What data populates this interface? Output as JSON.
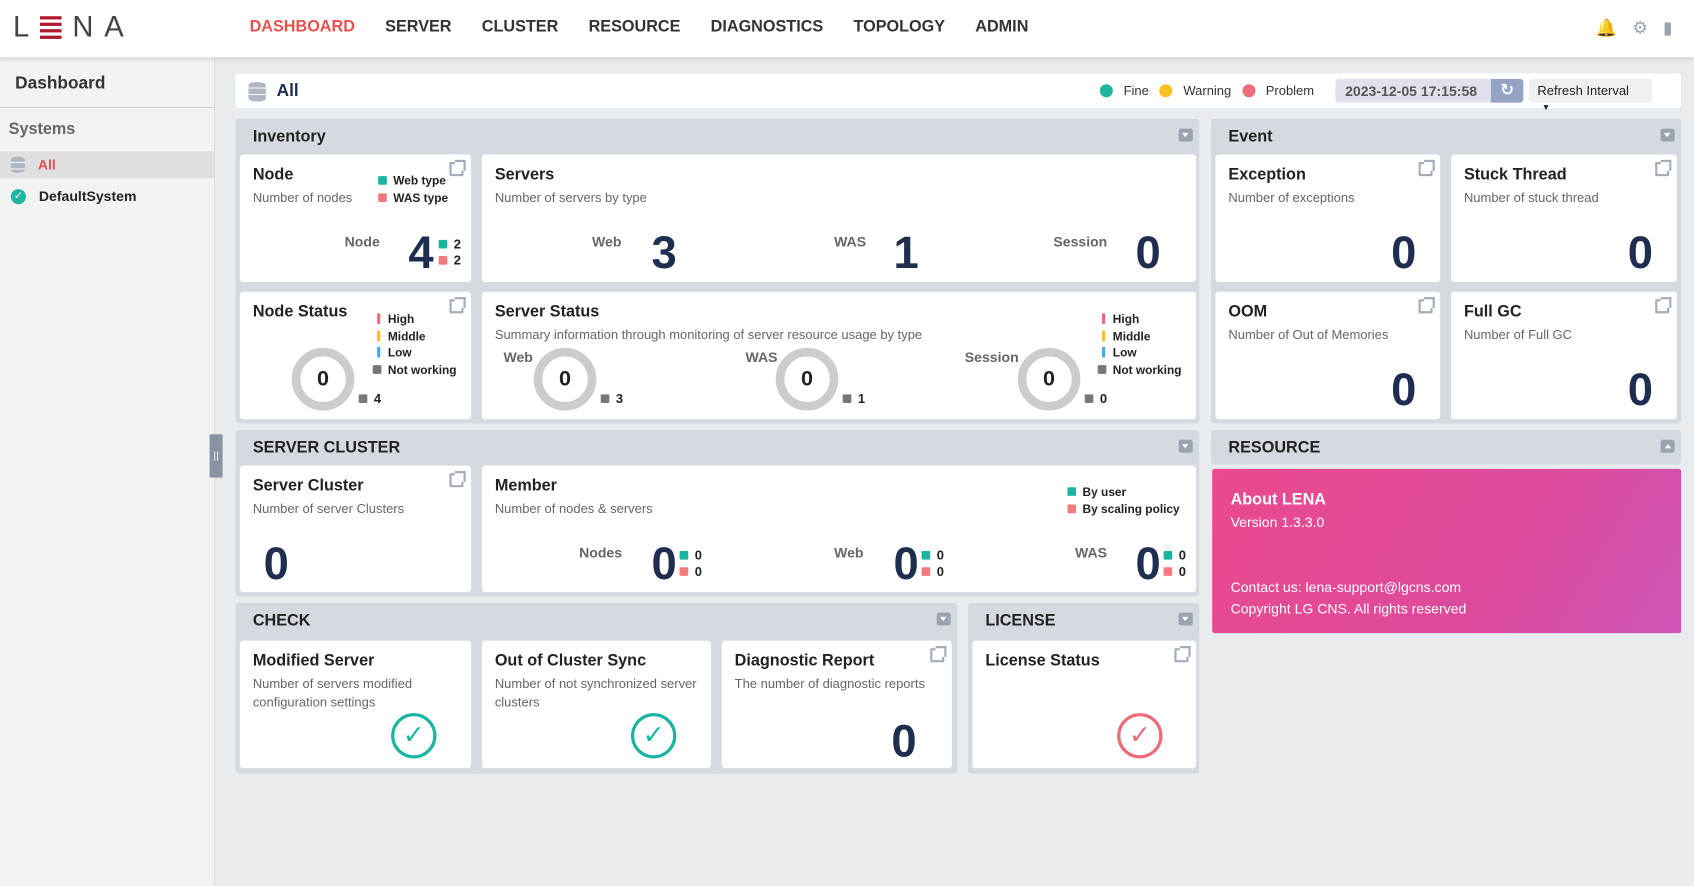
{
  "app": {
    "logo": "LENA"
  },
  "nav": [
    "DASHBOARD",
    "SERVER",
    "CLUSTER",
    "RESOURCE",
    "DIAGNOSTICS",
    "TOPOLOGY",
    "ADMIN"
  ],
  "nav_active": "DASHBOARD",
  "header_icons": [
    "bell-icon",
    "gear-icon",
    "logout-icon"
  ],
  "sidebar": {
    "title": "Dashboard",
    "section": "Systems",
    "items": [
      {
        "label": "All",
        "icon": "database-icon",
        "selected": true
      },
      {
        "label": "DefaultSystem",
        "icon": "check-circle-icon"
      }
    ]
  },
  "topbar": {
    "title": "All",
    "status": {
      "fine": "Fine",
      "warning": "Warning",
      "problem": "Problem"
    },
    "timestamp": "2023-12-05 17:15:58",
    "refresh_interval": "Refresh Interval"
  },
  "colors": {
    "accent": "#e9504f",
    "fine": "#1fb5a3",
    "warning": "#fbbf24",
    "problem": "#f06b7a",
    "web": "#1ab5a0",
    "was": "#f47a7e",
    "high": "#f06b7a",
    "middle": "#fbbf24",
    "low": "#4aa8f0",
    "not_working": "#777777"
  },
  "inventory": {
    "title": "Inventory",
    "node": {
      "title": "Node",
      "subtitle": "Number of nodes",
      "legend_web": "Web type",
      "legend_was": "WAS type",
      "label": "Node",
      "value": "4",
      "web": "2",
      "was": "2"
    },
    "servers": {
      "title": "Servers",
      "subtitle": "Number of servers by type",
      "web_label": "Web",
      "web": "3",
      "was_label": "WAS",
      "was": "1",
      "session_label": "Session",
      "session": "0"
    },
    "node_status": {
      "title": "Node Status",
      "legend": [
        "High",
        "Middle",
        "Low",
        "Not working"
      ],
      "value": "0",
      "not_working": "4"
    },
    "server_status": {
      "title": "Server Status",
      "subtitle": "Summary information through monitoring of server resource usage by type",
      "legend": [
        "High",
        "Middle",
        "Low",
        "Not working"
      ],
      "web_label": "Web",
      "web": "0",
      "web_nw": "3",
      "was_label": "WAS",
      "was": "0",
      "was_nw": "1",
      "session_label": "Session",
      "session": "0",
      "session_nw": "0"
    }
  },
  "event": {
    "title": "Event",
    "exception": {
      "title": "Exception",
      "subtitle": "Number of exceptions",
      "value": "0"
    },
    "stuck": {
      "title": "Stuck Thread",
      "subtitle": "Number of stuck thread",
      "value": "0"
    },
    "oom": {
      "title": "OOM",
      "subtitle": "Number of Out of Memories",
      "value": "0"
    },
    "fullgc": {
      "title": "Full GC",
      "subtitle": "Number of Full GC",
      "value": "0"
    }
  },
  "cluster": {
    "title": "SERVER CLUSTER",
    "server_cluster": {
      "title": "Server Cluster",
      "subtitle": "Number of server Clusters",
      "value": "0"
    },
    "member": {
      "title": "Member",
      "subtitle": "Number of nodes & servers",
      "legend_user": "By user",
      "legend_scaling": "By scaling policy",
      "nodes_label": "Nodes",
      "nodes": "0",
      "nodes_user": "0",
      "nodes_scaling": "0",
      "web_label": "Web",
      "web": "0",
      "web_user": "0",
      "web_scaling": "0",
      "was_label": "WAS",
      "was": "0",
      "was_user": "0",
      "was_scaling": "0"
    }
  },
  "resource": {
    "title": "RESOURCE",
    "about": "About LENA",
    "version": "Version 1.3.3.0",
    "contact": "Contact us: lena-support@lgcns.com",
    "copyright": "Copyright LG CNS. All rights reserved"
  },
  "check": {
    "title": "CHECK",
    "modified": {
      "title": "Modified Server",
      "subtitle": "Number of servers modified configuration settings",
      "status": "ok"
    },
    "sync": {
      "title": "Out of Cluster Sync",
      "subtitle": "Number of not synchronized server clusters",
      "status": "ok"
    },
    "diag": {
      "title": "Diagnostic Report",
      "subtitle": "The number of diagnostic reports",
      "value": "0"
    }
  },
  "license": {
    "title": "LICENSE",
    "status": {
      "title": "License Status",
      "status": "ok"
    }
  }
}
